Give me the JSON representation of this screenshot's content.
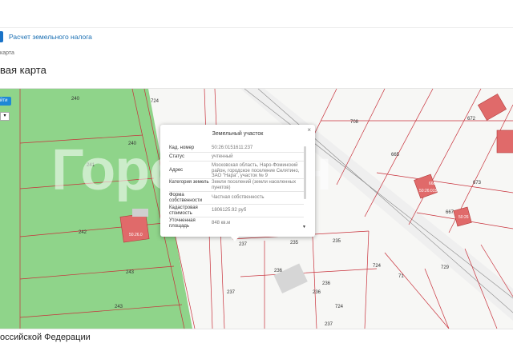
{
  "header": {
    "tax_link": "Расчет земельного налога",
    "breadcrumb": "карта",
    "page_title": "вая карта"
  },
  "map": {
    "search_button": "йти",
    "select_value": "",
    "watermark": "ГородМен",
    "parcel_labels": [
      "240",
      "724",
      "240",
      "241",
      "242",
      "243",
      "243",
      "708",
      "665",
      "672",
      "673",
      "667",
      "236",
      "237",
      "235",
      "235",
      "236",
      "237",
      "236",
      "724",
      "724",
      "729",
      "237",
      "71"
    ],
    "building_labels": [
      "50.26.0",
      "668",
      "50:26:015",
      "50:26"
    ]
  },
  "popup": {
    "title": "Земельный участок",
    "close": "×",
    "rows": [
      {
        "label": "Кад. номер",
        "value": "50:26:0151611:237"
      },
      {
        "label": "Статус",
        "value": "учтенный"
      },
      {
        "label": "Адрес",
        "value": "Московская область, Наро-Фоминский район, городское поселение Селятино, ЗАО \"Нара\", участок № 9"
      },
      {
        "label": "Категория земель",
        "value": "Земли поселений (земли населенных пунктов)"
      },
      {
        "label": "Форма собственности",
        "value": "Частная собственность"
      },
      {
        "label": "Кадастровая стоимость",
        "value": "1806125.92 руб"
      },
      {
        "label": "Уточненная площадь",
        "value": "848 кв.м"
      }
    ],
    "scroll_down": "▼"
  },
  "footer": {
    "title": "оссийской Федерации"
  }
}
